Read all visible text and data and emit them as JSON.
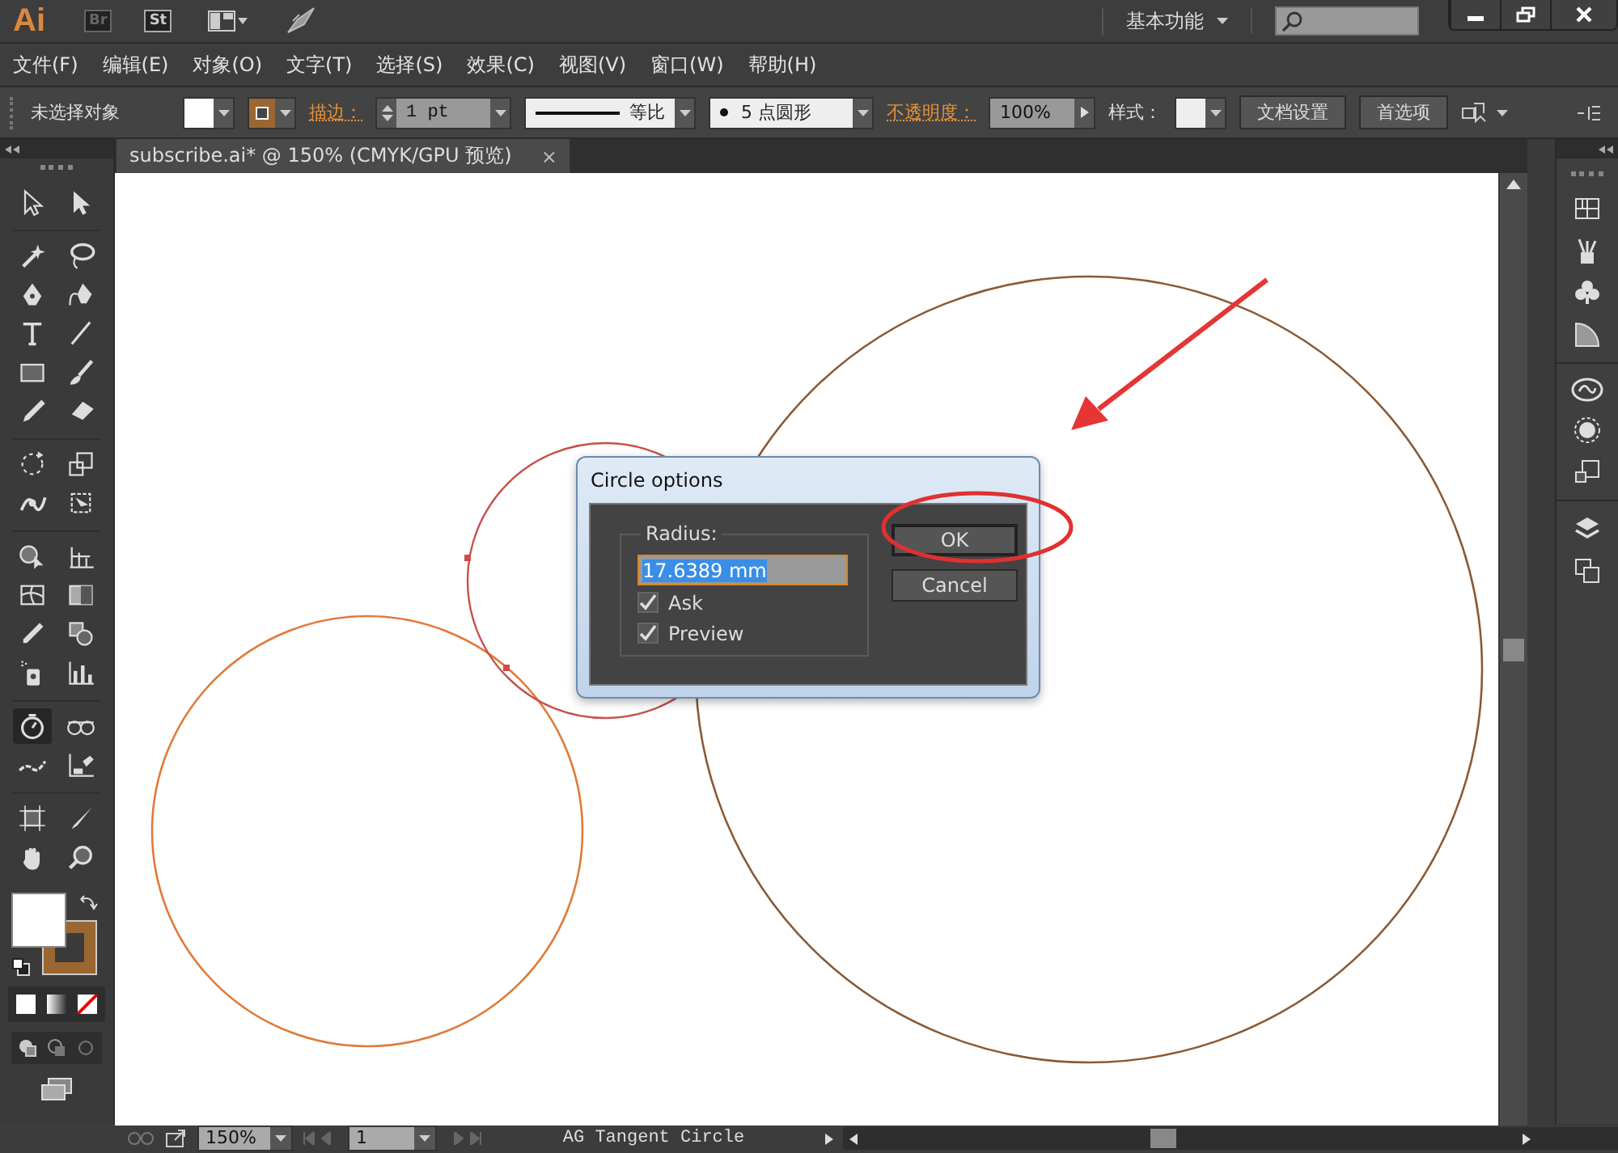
{
  "app_bar": {
    "logo": "Ai",
    "apps": [
      "Br",
      "St"
    ],
    "workspace": "基本功能"
  },
  "menu": [
    "文件(F)",
    "编辑(E)",
    "对象(O)",
    "文字(T)",
    "选择(S)",
    "效果(C)",
    "视图(V)",
    "窗口(W)",
    "帮助(H)"
  ],
  "control_bar": {
    "selection": "未选择对象",
    "stroke_label": "描边：",
    "stroke_weight": "1 pt",
    "stroke_profile": "等比",
    "brush": "5 点圆形",
    "opacity_label": "不透明度：",
    "opacity": "100%",
    "style_label": "样式：",
    "buttons": [
      "文档设置",
      "首选项"
    ]
  },
  "document_tab": {
    "title": "subscribe.ai* @ 150% (CMYK/GPU 预览)",
    "close": "×"
  },
  "tools": [
    {
      "kind": "selection-arrow",
      "selected": false
    },
    {
      "kind": "direct-selection-arrow",
      "selected": false
    },
    {
      "kind": "magic-wand",
      "selected": false
    },
    {
      "kind": "lasso",
      "selected": false
    },
    {
      "kind": "pen",
      "selected": false
    },
    {
      "kind": "curvature-pen",
      "selected": false
    },
    {
      "kind": "type",
      "selected": false
    },
    {
      "kind": "line",
      "selected": false
    },
    {
      "kind": "rectangle",
      "selected": false
    },
    {
      "kind": "paintbrush",
      "selected": false
    },
    {
      "kind": "pencil",
      "selected": false
    },
    {
      "kind": "eraser",
      "selected": false
    },
    {
      "kind": "rotate",
      "selected": false
    },
    {
      "kind": "scale",
      "selected": false
    },
    {
      "kind": "width",
      "selected": false
    },
    {
      "kind": "free-transform",
      "selected": false
    },
    {
      "kind": "shape-builder",
      "selected": false
    },
    {
      "kind": "perspective-grid",
      "selected": false
    },
    {
      "kind": "mesh",
      "selected": false
    },
    {
      "kind": "gradient",
      "selected": false
    },
    {
      "kind": "eyedropper",
      "selected": false
    },
    {
      "kind": "blend",
      "selected": false
    },
    {
      "kind": "sprayer",
      "selected": false
    },
    {
      "kind": "graph",
      "selected": false
    },
    {
      "kind": "stopwatch",
      "selected": true
    },
    {
      "kind": "glasses",
      "selected": false
    },
    {
      "kind": "wave",
      "selected": false
    },
    {
      "kind": "chart-eraser",
      "selected": false
    },
    {
      "kind": "artboard",
      "selected": false
    },
    {
      "kind": "knife",
      "selected": false
    },
    {
      "kind": "hand",
      "selected": false
    },
    {
      "kind": "zoom",
      "selected": false
    }
  ],
  "dialog": {
    "title": "Circle options",
    "group_label": "Radius:",
    "radius": {
      "value": "17.6389 mm",
      "selected": true
    },
    "options": [
      {
        "label": "Ask",
        "checked": true
      },
      {
        "label": "Preview",
        "checked": true
      }
    ],
    "buttons": [
      "OK",
      "Cancel"
    ]
  },
  "status_bar": {
    "zoom": "150%",
    "artboard": "1",
    "status": "AG Tangent Circle"
  }
}
